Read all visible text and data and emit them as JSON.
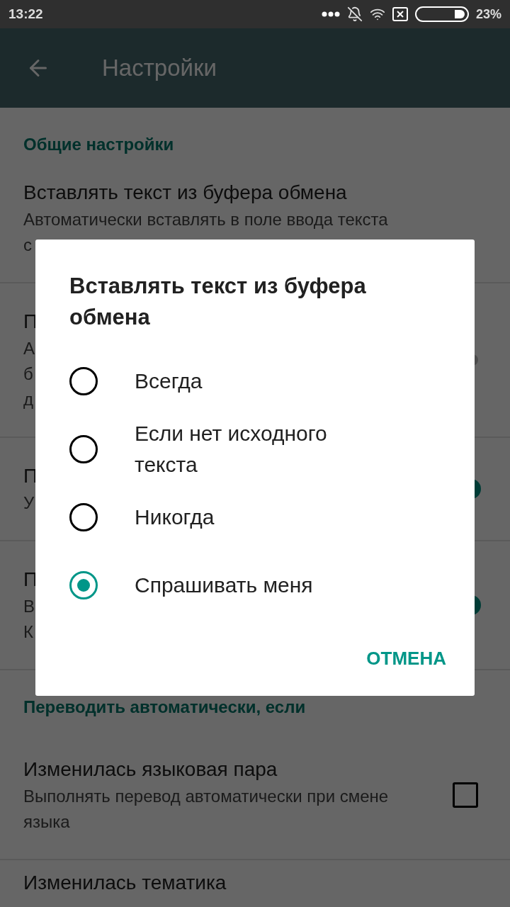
{
  "status_bar": {
    "time": "13:22",
    "battery": "23%"
  },
  "app_bar": {
    "title": "Настройки"
  },
  "settings": [
    {
      "kind": "header",
      "title": "Общие настройки"
    },
    {
      "kind": "item",
      "lines": [
        "Вставлять текст из буфера обмена",
        "Автоматически вставлять в поле ввода текста",
        "с"
      ]
    },
    {
      "kind": "switch",
      "lines": [
        "П",
        "А",
        "б",
        "д"
      ],
      "on": false
    },
    {
      "kind": "switch",
      "lines": [
        "П",
        "У"
      ],
      "on": true
    },
    {
      "kind": "switch",
      "lines": [
        "П",
        "В",
        "К"
      ],
      "on": true
    },
    {
      "kind": "header",
      "title": "Переводить автоматически, если"
    },
    {
      "kind": "checkbox",
      "lines": [
        "Изменилась языковая пара",
        "Выполнять перевод автоматически при смене языка"
      ],
      "checked": false
    },
    {
      "kind": "item",
      "lines": [
        "Изменилась тематика"
      ]
    }
  ],
  "dialog": {
    "title": "Вставлять текст из буфера обмена",
    "options": [
      {
        "label": "Всегда",
        "selected": false
      },
      {
        "label": "Если нет исходного текста",
        "selected": false
      },
      {
        "label": "Никогда",
        "selected": false
      },
      {
        "label": "Спрашивать меня",
        "selected": true
      }
    ],
    "buttons": [
      "ОТМЕНА"
    ]
  }
}
